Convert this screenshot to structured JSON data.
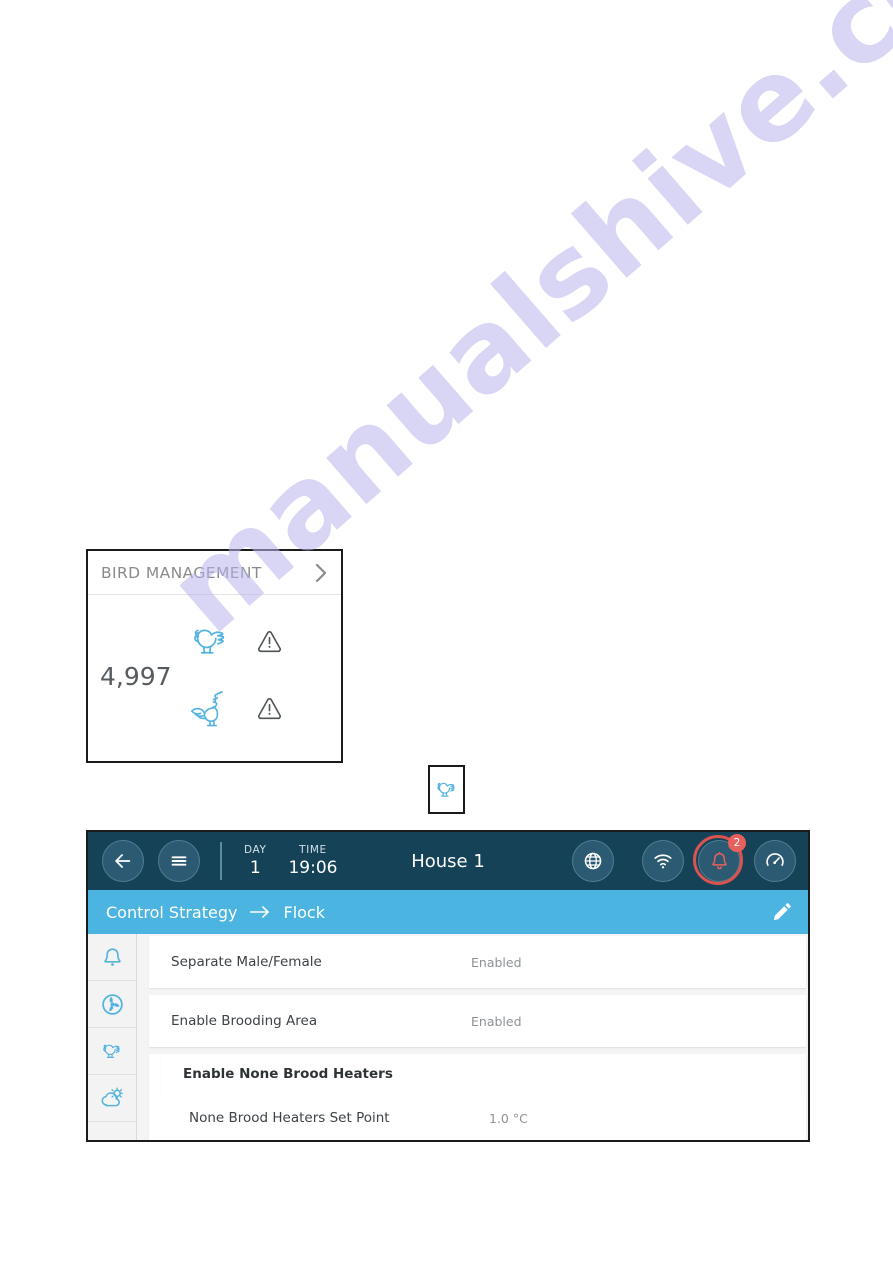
{
  "watermark": {
    "text": "manualshive.com"
  },
  "bird_management_card": {
    "title": "BIRD MANAGEMENT",
    "chevron_icon": "chevron-right-icon",
    "count": "4,997",
    "rows": [
      {
        "animal_icon": "hen-icon",
        "warning_icon": "warning-triangle-icon"
      },
      {
        "animal_icon": "rooster-icon",
        "warning_icon": "warning-triangle-icon"
      }
    ]
  },
  "hen_chip": {
    "icon": "hen-icon"
  },
  "device": {
    "topbar": {
      "back_icon": "back-arrow-icon",
      "menu_icon": "hamburger-menu-icon",
      "day_label": "DAY",
      "day_value": "1",
      "time_label": "TIME",
      "time_value": "19:06",
      "house_title": "House 1",
      "globe_icon": "globe-icon",
      "wifi_icon": "wifi-icon",
      "alarm_icon": "bell-icon",
      "alarm_badge": "2",
      "gauge_icon": "gauge-icon"
    },
    "breadcrumb": {
      "parent": "Control Strategy",
      "arrow_icon": "arrow-right-icon",
      "current": "Flock",
      "edit_icon": "pencil-edit-icon"
    },
    "sidebar": {
      "items": [
        {
          "icon": "bell-icon",
          "name": "alarms"
        },
        {
          "icon": "fan-icon",
          "name": "ventilation"
        },
        {
          "icon": "hen-icon",
          "name": "bird"
        },
        {
          "icon": "weather-icon",
          "name": "weather"
        }
      ]
    },
    "settings": [
      {
        "label": "Separate Male/Female",
        "value": "Enabled"
      },
      {
        "label": "Enable Brooding Area",
        "value": "Enabled"
      }
    ],
    "group": {
      "header": "Enable None Brood Heaters",
      "rows": [
        {
          "label": "None Brood Heaters Set Point",
          "value": "1.0 °C"
        }
      ]
    }
  },
  "colors": {
    "topbar": "#164258",
    "breadcrumb": "#4bb4e0",
    "icon_blue": "#55b3e0",
    "alarm_red": "#d9534f",
    "badge_red": "#e8605c"
  }
}
